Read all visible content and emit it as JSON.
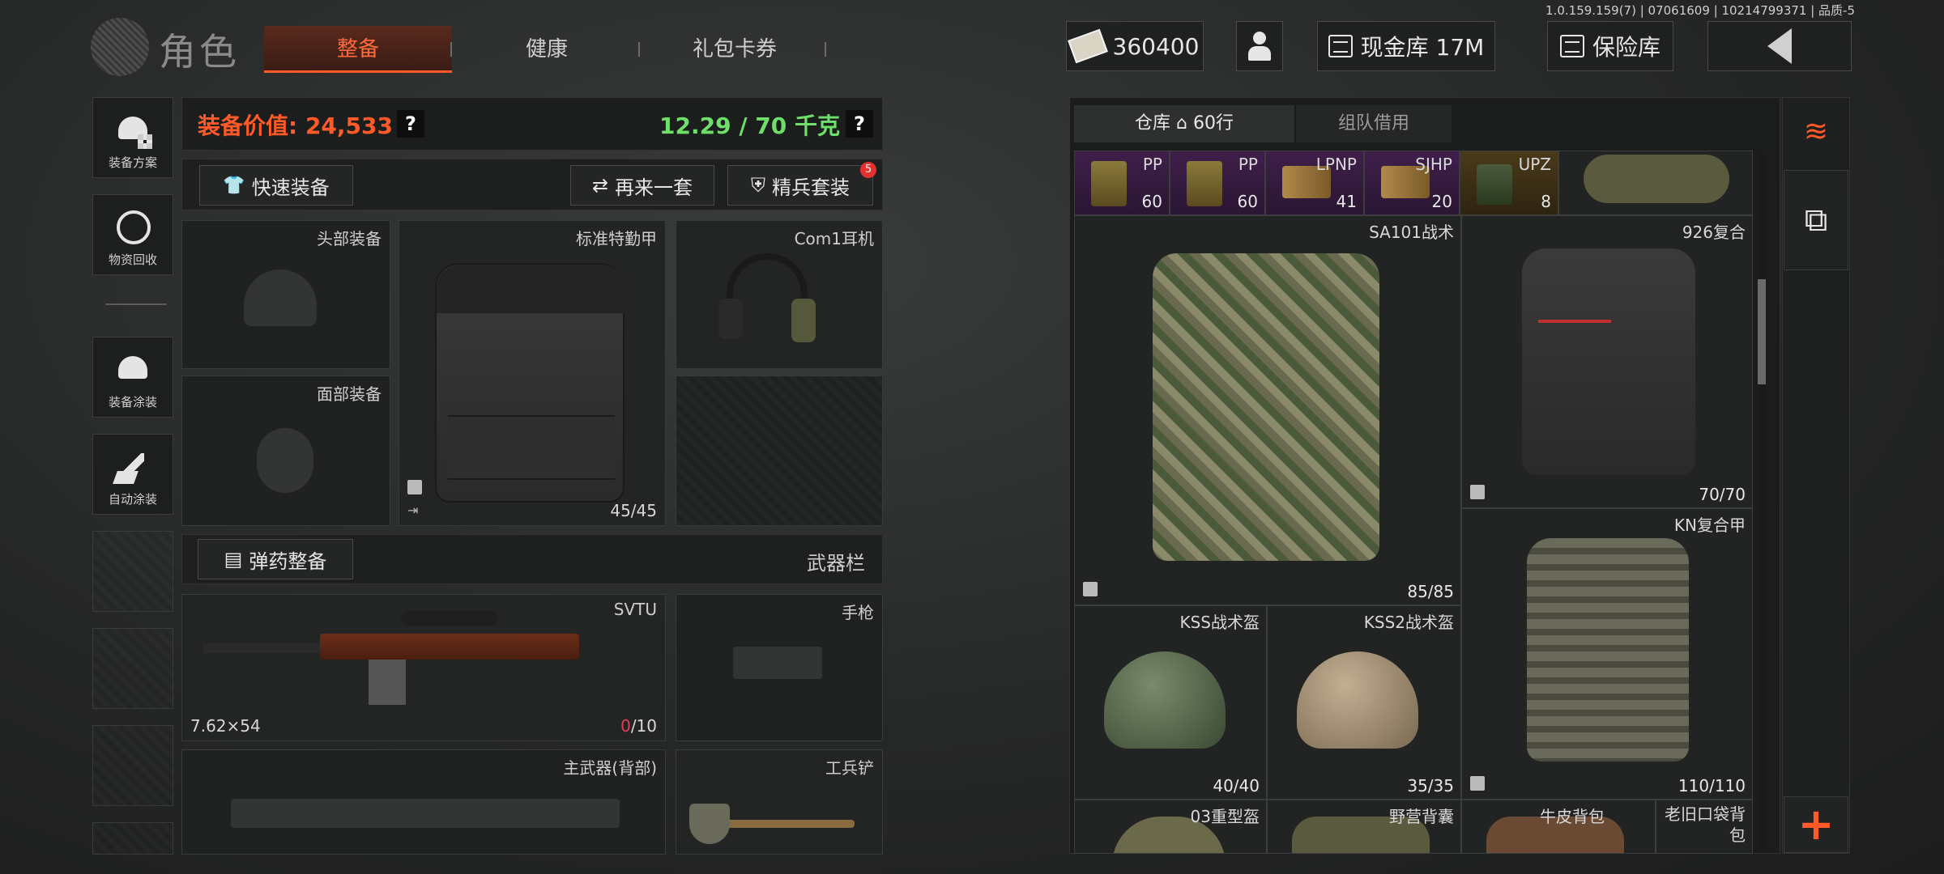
{
  "version": "1.0.159.159(7) | 07061609 | 10214799371 | 品质-5",
  "header": {
    "title": "角色",
    "tabs": [
      {
        "label": "整备",
        "active": true
      },
      {
        "label": "健康",
        "active": false
      },
      {
        "label": "礼包卡券",
        "active": false
      }
    ],
    "currency": "360400",
    "cash_vault": "现金库 17M",
    "insurance": "保险库"
  },
  "sidebar": {
    "items": [
      {
        "label": "装备方案",
        "icon": "helmet-grid-icon"
      },
      {
        "label": "物资回收",
        "icon": "recycle-icon"
      },
      {
        "label": "装备涂装",
        "icon": "helmet-paint-icon"
      },
      {
        "label": "自动涂装",
        "icon": "auto-paint-icon"
      }
    ]
  },
  "equipment": {
    "value_label": "装备价值: 24,533",
    "weight_label": "12.29 / 70 千克",
    "help": "?",
    "quick_equip": "快速装备",
    "again": "再来一套",
    "elite": "精兵套装",
    "elite_badge": "5",
    "slots": {
      "head": "头部装备",
      "face": "面部装备",
      "armor_name": "标准特勤甲",
      "armor_durability": "45/45",
      "ear_name": "Com1耳机",
      "ammo_loadout": "弹药整备",
      "weapon_bar": "武器栏",
      "primary_name": "SVTU",
      "primary_caliber": "7.62×54",
      "primary_ammo_loaded": "0",
      "primary_ammo_cap": "/10",
      "pistol": "手枪",
      "primary_back": "主武器(背部)",
      "melee": "工兵铲"
    }
  },
  "stash": {
    "tab_main": "仓库",
    "rows": "60行",
    "tab_team": "组队借用",
    "ammo": [
      {
        "name": "PP",
        "count": "60"
      },
      {
        "name": "PP",
        "count": "60"
      },
      {
        "name": "LPNP",
        "count": "41"
      },
      {
        "name": "SJHP",
        "count": "20"
      },
      {
        "name": "UPZ",
        "count": "8"
      }
    ],
    "items": [
      {
        "name": "SA101战术",
        "count": "85/85"
      },
      {
        "name": "926复合",
        "count": "70/70"
      },
      {
        "name": "KN复合甲",
        "count": "110/110"
      },
      {
        "name": "KSS战术盔",
        "count": "40/40"
      },
      {
        "name": "KSS2战术盔",
        "count": "35/35"
      },
      {
        "name": "03重型盔",
        "count": ""
      },
      {
        "name": "野营背囊",
        "count": ""
      },
      {
        "name": "牛皮背包",
        "count": ""
      },
      {
        "name": "老旧口袋背包",
        "count": ""
      }
    ]
  },
  "colors": {
    "accent": "#ff5a28",
    "weight_ok": "#6ee06a",
    "ammo_cell": "#3f1f4a",
    "ammo_cell_gold": "#4a3a1a",
    "badge": "#e53030"
  }
}
